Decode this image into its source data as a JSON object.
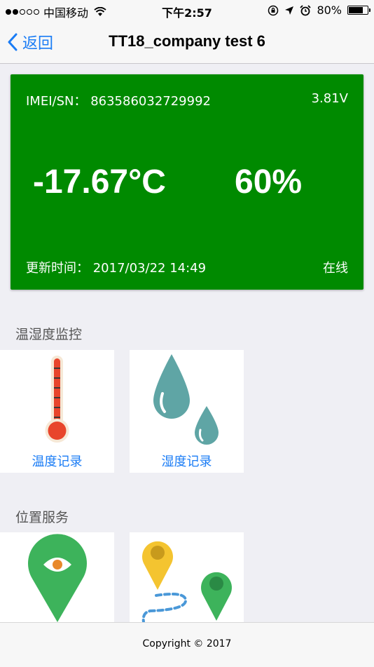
{
  "status_bar": {
    "carrier": "中国移动",
    "time": "下午2:57",
    "battery_percent": "80%",
    "battery_level": 0.8,
    "signal_strength": 2
  },
  "nav": {
    "back_label": "返回",
    "title": "TT18_company test 6"
  },
  "device": {
    "imei": "IMEI/SN：  863586032729992",
    "voltage": "3.81V",
    "temperature": "-17.67°C",
    "humidity": "60%",
    "updated": "更新时间：  2017/03/22 14:49",
    "status": "在线",
    "card_color": "#008a00"
  },
  "sections": {
    "monitoring_title": "温湿度监控",
    "monitoring_tiles": [
      {
        "label": "温度记录",
        "icon": "thermometer-icon"
      },
      {
        "label": "湿度记录",
        "icon": "water-drops-icon"
      }
    ],
    "location_title": "位置服务",
    "location_tiles": [
      {
        "label": "",
        "icon": "location-eye-pin-icon"
      },
      {
        "label": "",
        "icon": "route-pins-icon"
      }
    ]
  },
  "footer": {
    "copyright": "Copyright © 2017"
  },
  "colors": {
    "accent": "#1a7cf5",
    "background": "#efeff4"
  }
}
